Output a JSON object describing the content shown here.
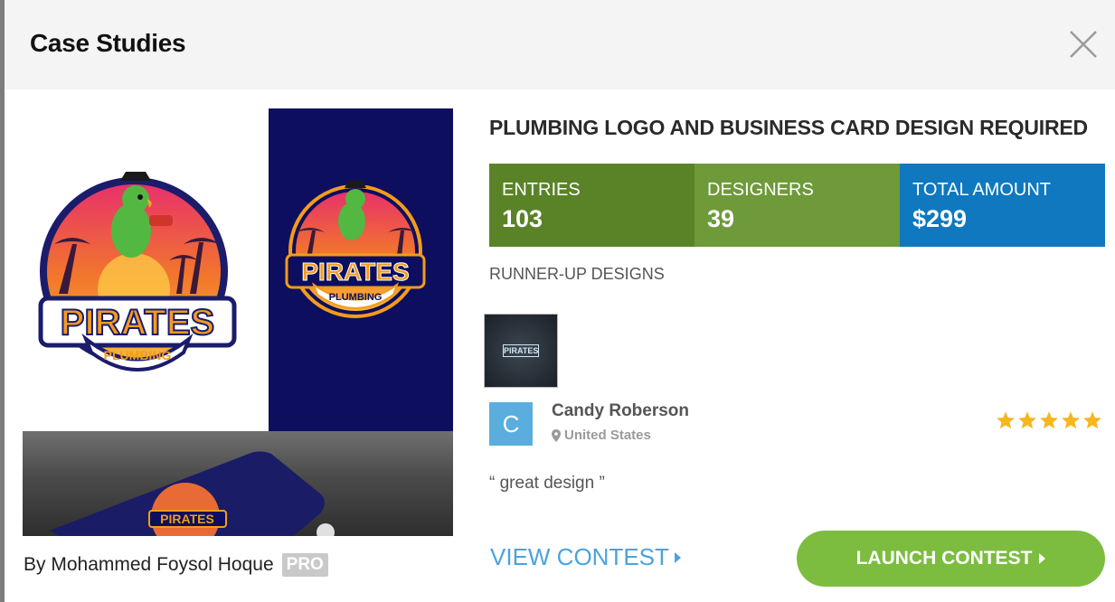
{
  "modal": {
    "title": "Case Studies",
    "close_icon": "close-icon"
  },
  "design": {
    "logo_text": "PIRATES",
    "logo_subtext": "PLUMBING",
    "author_prefix": "By",
    "author_name": "Mohammed Foysol Hoque",
    "pro_badge": "PRO"
  },
  "contest": {
    "title": "PLUMBING LOGO AND BUSINESS CARD DESIGN REQUIRED",
    "stats": [
      {
        "label": "ENTRIES",
        "value": "103",
        "color": "#5a8328"
      },
      {
        "label": "DESIGNERS",
        "value": "39",
        "color": "#6e9a3a"
      },
      {
        "label": "TOTAL AMOUNT",
        "value": "$299",
        "color": "#0f78be"
      }
    ]
  },
  "runner_up": {
    "heading": "RUNNER-UP DESIGNS",
    "thumb_text": "PIRATES"
  },
  "review": {
    "avatar_letter": "C",
    "name": "Candy Roberson",
    "country": "United States",
    "rating": 5,
    "quote": "“ great design ”"
  },
  "actions": {
    "view_contest": "VIEW CONTEST",
    "launch_contest": "LAUNCH CONTEST"
  },
  "colors": {
    "accent_green": "#7cbd3f",
    "link_blue": "#4ba3dd",
    "star_gold": "#f5b71d",
    "navy": "#0d0f5e"
  }
}
